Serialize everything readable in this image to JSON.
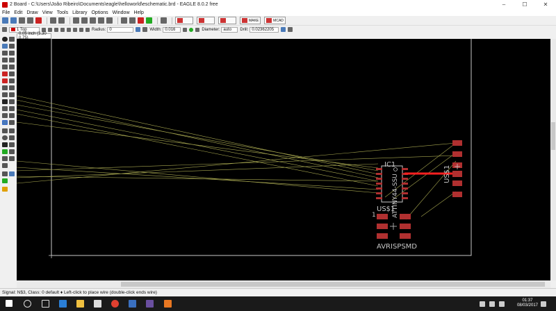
{
  "window": {
    "title": "2 Board - C:\\Users\\João Ribeiro\\Documents\\eagle\\helloworld\\eschematic.brd - EAGLE 8.0.2 free"
  },
  "menu": [
    "File",
    "Edit",
    "Draw",
    "View",
    "Tools",
    "Library",
    "Options",
    "Window",
    "Help"
  ],
  "toolbar": {
    "make_label": "MAKE",
    "mcad_label": "MCAD"
  },
  "params": {
    "layer": "1 Top",
    "radius_label": "Radius:",
    "radius_value": "0",
    "width_label": "Width:",
    "width_value": "0.016",
    "diameter_label": "Diameter:",
    "diameter_value": "auto",
    "drill_label": "Drill:",
    "drill_value": "0.02362205"
  },
  "coords": "0.05 inch (3.30 0.75)",
  "board": {
    "ic1_name": "IC1",
    "ic1_value": "ATTINY44-SSU",
    "avr_name": "US$1",
    "avr_value": "AVRISPSMD",
    "pin_one": "1",
    "usb_name": "US$1"
  },
  "status": "Signal: N$3, Class: 0 default  ♦ Left-click to place wire (double-click ends wire)",
  "clock": {
    "time": "01:37",
    "date": "08/03/2017"
  },
  "colors": {
    "canvas": "#000000",
    "pad": "#b03030",
    "airwire": "#b8b84a",
    "trace": "#ff2020",
    "outline": "#cccccc"
  }
}
